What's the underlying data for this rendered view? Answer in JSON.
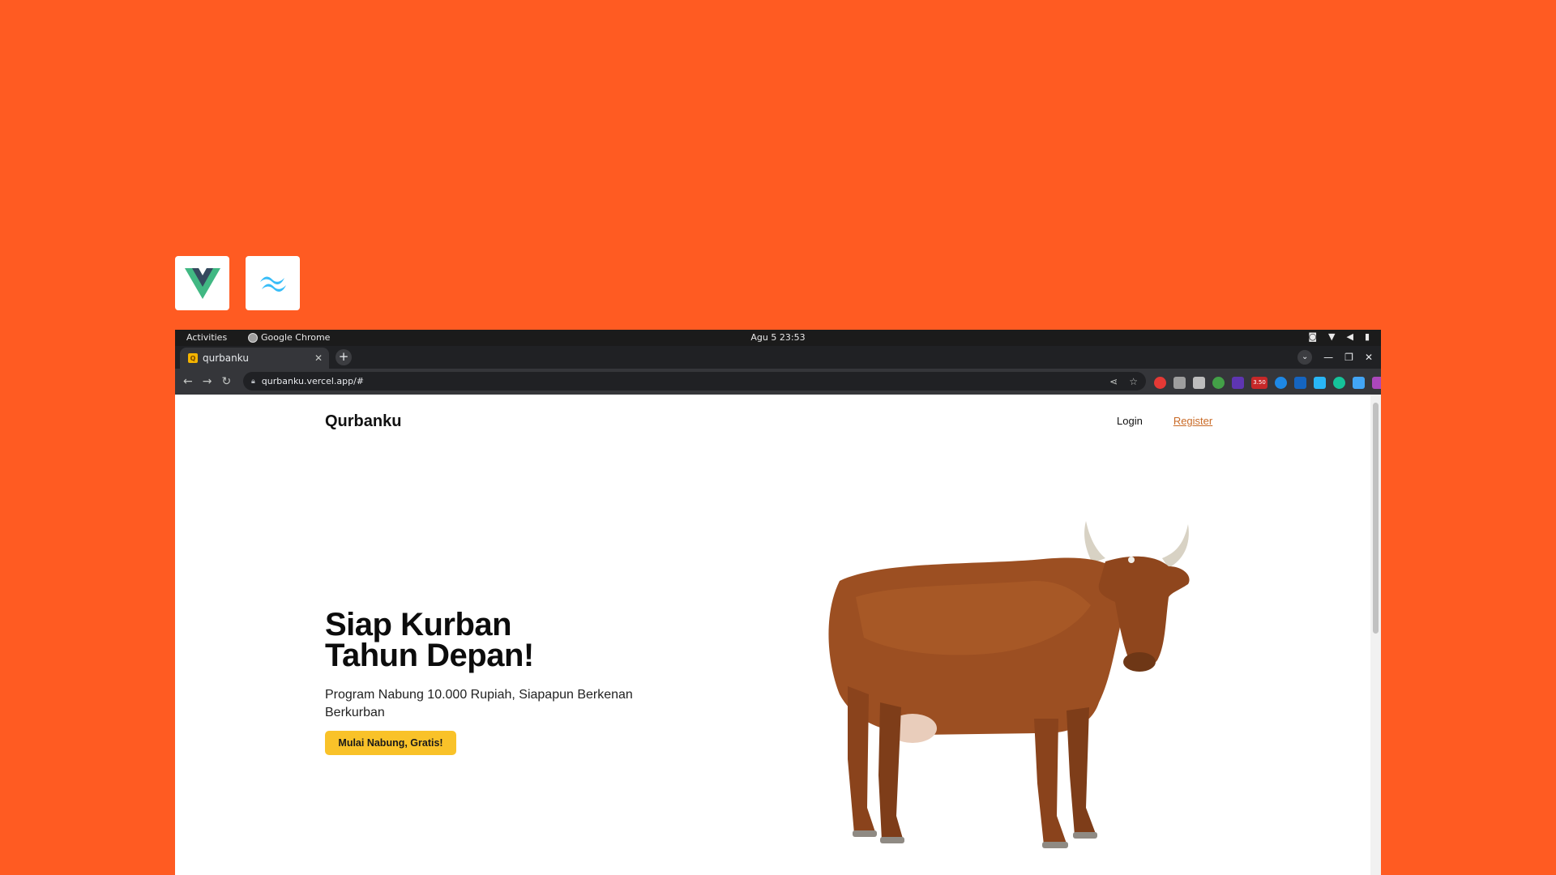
{
  "os_bar": {
    "activities": "Activities",
    "app_name": "Google Chrome",
    "clock": "Agu 5  23:53"
  },
  "browser": {
    "tab_title": "qurbanku",
    "url": "qurbanku.vercel.app/#",
    "extensions": [
      {
        "icon": "red-circle-icon",
        "color": "#e53935"
      },
      {
        "icon": "card-icon",
        "color": "#9e9e9e"
      },
      {
        "icon": "camera-icon",
        "color": "#bdbdbd"
      },
      {
        "icon": "triangle-icon",
        "color": "#43a047"
      },
      {
        "icon": "purple-badge-icon",
        "color": "#5e35b1"
      },
      {
        "icon": "price-badge-icon",
        "color": "#c62828",
        "badge": "3.50"
      },
      {
        "icon": "translate-icon",
        "color": "#1e88e5"
      },
      {
        "icon": "chat-badge-icon",
        "color": "#1565c0"
      },
      {
        "icon": "heart-icon",
        "color": "#29b6f6"
      },
      {
        "icon": "grammarly-icon",
        "color": "#15c39a"
      },
      {
        "icon": "book-icon",
        "color": "#42a5f5"
      },
      {
        "icon": "colorful-icon",
        "color": "#ab47bc"
      },
      {
        "icon": "red-square-icon",
        "color": "#ef5350"
      },
      {
        "icon": "gray-star-icon",
        "color": "#616161"
      },
      {
        "icon": "gear-icon",
        "color": "#9e9e9e"
      },
      {
        "icon": "puzzle-icon",
        "color": "#9e9e9e"
      },
      {
        "icon": "playlist-icon",
        "color": "#9e9e9e"
      },
      {
        "icon": "sidepanel-icon",
        "color": "#9e9e9e"
      }
    ]
  },
  "page": {
    "brand": "Qurbanku",
    "nav": {
      "login": "Login",
      "register": "Register"
    },
    "hero": {
      "headline_line1": "Siap Kurban",
      "headline_line2": "Tahun Depan!",
      "subtitle": "Program Nabung 10.000 Rupiah, Siapapun Berkenan Berkurban",
      "cta": "Mulai Nabung, Gratis!"
    }
  },
  "colors": {
    "background": "#ff5b22",
    "accent": "#f9c229",
    "register_link": "#c96a26"
  }
}
